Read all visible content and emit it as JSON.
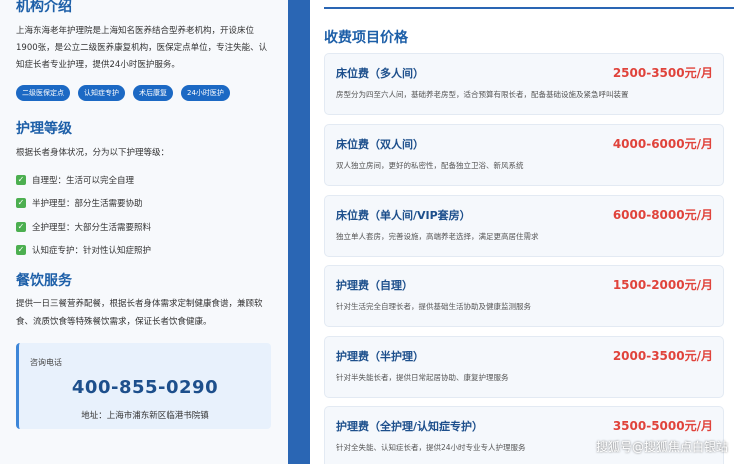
{
  "intro": {
    "title": "机构介绍",
    "text": "上海东海老年护理院是上海知名医养结合型养老机构，开设床位1900张，是公立二级医养康复机构，医保定点单位，专注失能、认知症长者专业护理，提供24小时医护服务。",
    "tags": [
      "二级医保定点",
      "认知症专护",
      "术后康复",
      "24小时医护"
    ]
  },
  "care": {
    "title": "护理等级",
    "desc": "根据长者身体状况，分为以下护理等级：",
    "items": [
      "自理型：生活可以完全自理",
      "半护理型：部分生活需要协助",
      "全护理型：大部分生活需要照料",
      "认知症专护：针对性认知症照护"
    ]
  },
  "food": {
    "title": "餐饮服务",
    "text": "提供一日三餐营养配餐，根据长者身体需求定制健康食谱，兼顾软食、流质饮食等特殊餐饮需求，保证长者饮食健康。"
  },
  "contact": {
    "label": "咨询电话",
    "phone": "400-855-0290",
    "address": "地址：上海市浦东新区临港书院镇"
  },
  "pricing": {
    "title": "收费项目价格",
    "items": [
      {
        "name": "床位费（多人间）",
        "price": "2500-3500元/月",
        "desc": "房型分为四至六人间，基础养老房型，适合预算有限长者，配备基础设施及紧急呼叫装置"
      },
      {
        "name": "床位费（双人间）",
        "price": "4000-6000元/月",
        "desc": "双人独立房间，更好的私密性，配备独立卫浴、新风系统"
      },
      {
        "name": "床位费（单人间/VIP套房）",
        "price": "6000-8000元/月",
        "desc": "独立单人套房，完善设施，高端养老选择，满足更高居住需求"
      },
      {
        "name": "护理费（自理）",
        "price": "1500-2000元/月",
        "desc": "针对生活完全自理长者，提供基础生活协助及健康监测服务"
      },
      {
        "name": "护理费（半护理）",
        "price": "2000-3500元/月",
        "desc": "针对半失能长者，提供日常起居协助、康复护理服务"
      },
      {
        "name": "护理费（全护理/认知症专护）",
        "price": "3500-5000元/月",
        "desc": "针对全失能、认知症长者，提供24小时专业专人护理服务"
      }
    ]
  },
  "watermark": "搜狐号@搜狐焦点白银站",
  "colors": {
    "accent": "#1d5fa8",
    "divider": "#2a66b4",
    "price": "#e0433b",
    "check": "#4caf50"
  }
}
